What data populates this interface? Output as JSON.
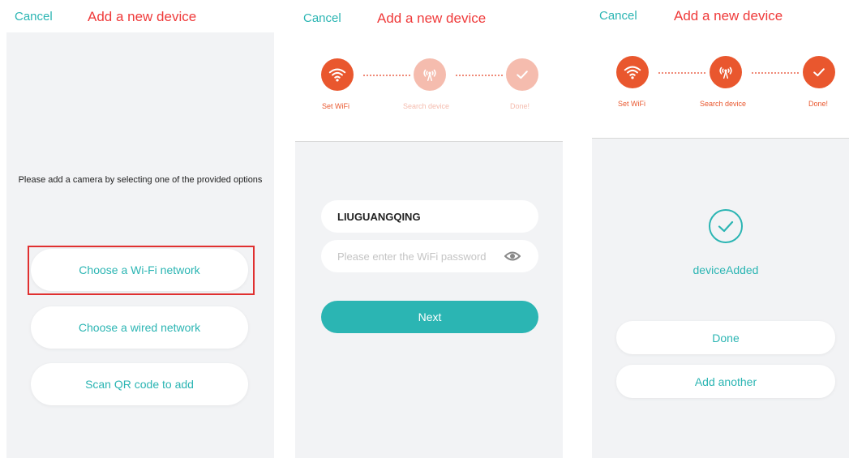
{
  "colors": {
    "accent": "#2bb5b3",
    "title": "#ef3a3a",
    "step_active": "#e9572e",
    "step_inactive": "#f5bcae"
  },
  "screen1": {
    "cancel": "Cancel",
    "title": "Add a new device",
    "prompt": "Please add a camera by selecting one of the provided options",
    "options": [
      "Choose a Wi-Fi network",
      "Choose a wired network",
      "Scan QR code to add"
    ]
  },
  "screen2": {
    "cancel": "Cancel",
    "title": "Add a new device",
    "steps": [
      {
        "label": "Set WiFi",
        "icon": "wifi-icon",
        "state": "active"
      },
      {
        "label": "Search device",
        "icon": "signal-tower-icon",
        "state": "inactive"
      },
      {
        "label": "Done!",
        "icon": "check-icon",
        "state": "inactive"
      }
    ],
    "ssid": "LIUGUANGQING",
    "password_placeholder": "Please enter the WiFi password",
    "next": "Next"
  },
  "screen3": {
    "cancel": "Cancel",
    "title": "Add a new device",
    "steps": [
      {
        "label": "Set WiFi",
        "icon": "wifi-icon",
        "state": "active"
      },
      {
        "label": "Search device",
        "icon": "signal-tower-icon",
        "state": "active"
      },
      {
        "label": "Done!",
        "icon": "check-icon",
        "state": "active"
      }
    ],
    "status": "deviceAdded",
    "done": "Done",
    "add_another": "Add another"
  }
}
